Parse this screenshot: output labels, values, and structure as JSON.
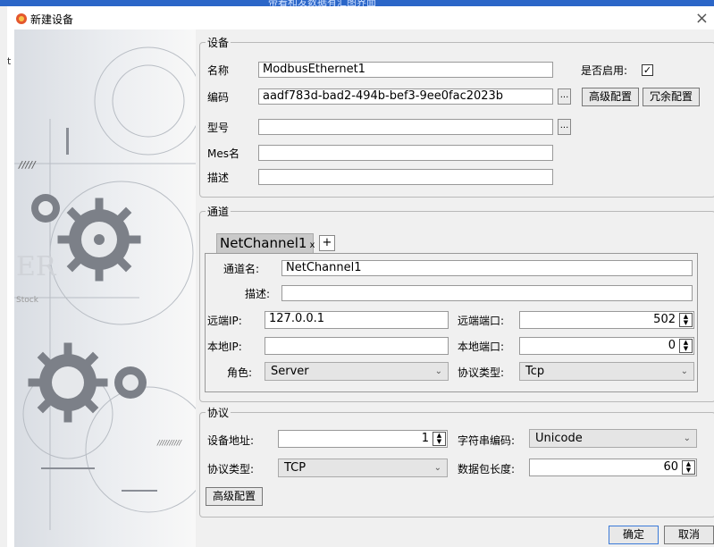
{
  "background": {
    "top_text": "带着和发数据有汇图界面"
  },
  "dialog": {
    "title": "新建设备",
    "close": "×"
  },
  "left_edge_char": "t",
  "device": {
    "legend": "设备",
    "name_label": "名称",
    "name_value": "ModbusEthernet1",
    "code_label": "编码",
    "code_value": "aadf783d-bad2-494b-bef3-9ee0fac2023b",
    "model_label": "型号",
    "model_value": "",
    "mes_label": "Mes名",
    "mes_value": "",
    "desc_label": "描述",
    "desc_value": "",
    "enabled_label": "是否启用:",
    "enabled_mark": "✓",
    "ellipsis": "...",
    "advanced": "高级配置",
    "redundant": "冗余配置"
  },
  "channel": {
    "legend": "通道",
    "tab": "NetChannel1",
    "tab_close": "x",
    "tab_add": "+",
    "name_label": "通道名:",
    "name_value": "NetChannel1",
    "desc_label": "描述:",
    "desc_value": "",
    "remote_ip_label": "远端IP:",
    "remote_ip_value": "127.0.0.1",
    "remote_port_label": "远端端口:",
    "remote_port_value": "502",
    "local_ip_label": "本地IP:",
    "local_ip_value": "",
    "local_port_label": "本地端口:",
    "local_port_value": "0",
    "role_label": "角色:",
    "role_value": "Server",
    "proto_label": "协议类型:",
    "proto_value": "Tcp"
  },
  "protocol": {
    "legend": "协议",
    "addr_label": "设备地址:",
    "addr_value": "1",
    "enc_label": "字符串编码:",
    "enc_value": "Unicode",
    "type_label": "协议类型:",
    "type_value": "TCP",
    "len_label": "数据包长度:",
    "len_value": "60",
    "advanced": "高级配置"
  },
  "footer": {
    "ok": "确定",
    "cancel": "取消"
  },
  "art_text": {
    "stripes": "/////",
    "er": "ER",
    "stock": "Stock",
    "tiny": "//////////"
  },
  "colors": {
    "accent": "#2b66c8",
    "title_icon": "#e4572e"
  }
}
